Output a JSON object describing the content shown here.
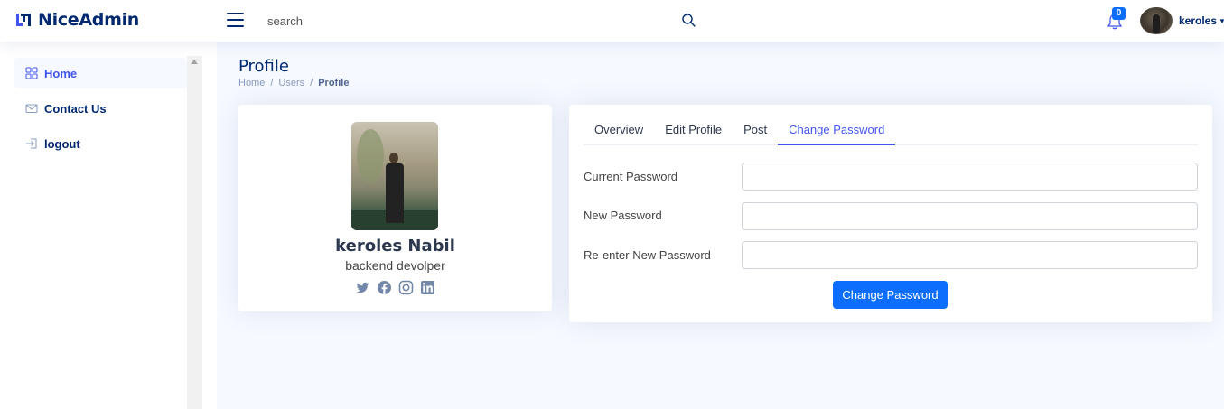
{
  "app": {
    "brand": "NiceAdmin"
  },
  "header": {
    "search_placeholder": "search",
    "notifications_count": "0",
    "user_name": "keroles"
  },
  "sidebar": {
    "items": [
      {
        "label": "Home",
        "icon": "grid-icon",
        "active": true
      },
      {
        "label": "Contact Us",
        "icon": "envelope-icon",
        "active": false
      },
      {
        "label": "logout",
        "icon": "box-arrow-in-right-icon",
        "active": false
      }
    ]
  },
  "page": {
    "title": "Profile",
    "breadcrumb": [
      "Home",
      "Users",
      "Profile"
    ]
  },
  "profile_card": {
    "name": "keroles Nabil",
    "job": "backend devolper",
    "social": [
      "twitter-icon",
      "facebook-icon",
      "instagram-icon",
      "linkedin-icon"
    ]
  },
  "tabs": [
    "Overview",
    "Edit Profile",
    "Post",
    "Change Password"
  ],
  "active_tab": "Change Password",
  "form": {
    "current_password_label": "Current Password",
    "new_password_label": "New Password",
    "renew_password_label": "Re-enter New Password",
    "submit_label": "Change Password"
  },
  "colors": {
    "brand": "#012970",
    "accent": "#4154f1",
    "primary_button": "#0d6efd",
    "page_bg": "#f6f9ff"
  }
}
